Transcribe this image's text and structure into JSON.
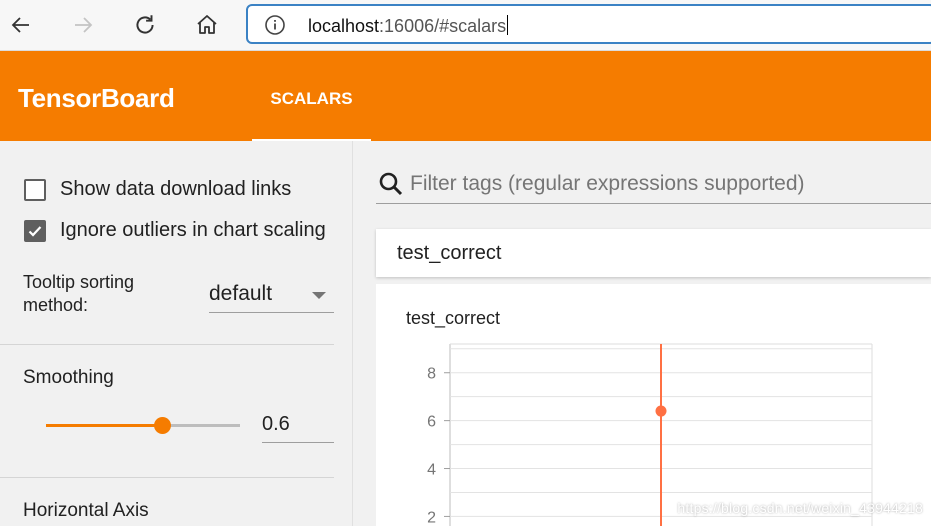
{
  "browser": {
    "url_host": "localhost",
    "url_rest": ":16006/#scalars",
    "icons": [
      "back-arrow-icon",
      "forward-arrow-icon",
      "reload-icon",
      "home-icon",
      "info-icon"
    ]
  },
  "header": {
    "brand": "TensorBoard",
    "tabs": [
      {
        "label": "SCALARS",
        "active": true
      }
    ],
    "color": "#f57c00"
  },
  "sidebar": {
    "show_download_links": {
      "label": "Show data download links",
      "checked": false
    },
    "ignore_outliers": {
      "label": "Ignore outliers in chart scaling",
      "checked": true
    },
    "tooltip_sorting": {
      "label": "Tooltip sorting method:",
      "value": "default"
    },
    "smoothing": {
      "title": "Smoothing",
      "value": "0.6",
      "fraction": 0.6
    },
    "horizontal_axis": {
      "title": "Horizontal Axis"
    }
  },
  "main": {
    "filter_placeholder": "Filter tags (regular expressions supported)",
    "card_title": "test_correct"
  },
  "chart_data": {
    "type": "line",
    "title": "test_correct",
    "xlabel": "",
    "ylabel": "",
    "ylim": [
      1.6,
      9.2
    ],
    "yticks": [
      "8",
      "6",
      "4",
      "2"
    ],
    "series": [
      {
        "points": [
          [
            0,
            6.4
          ]
        ],
        "color": "#ff7043"
      }
    ],
    "grid": true
  },
  "watermark": "https://blog.csdn.net/weixin_43944218"
}
